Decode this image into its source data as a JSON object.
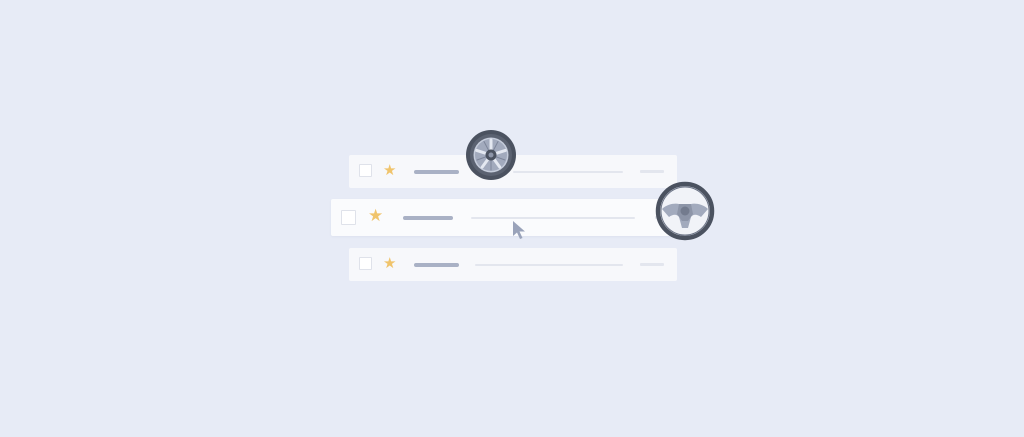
{
  "illustration": {
    "rows": [
      {
        "starred": true,
        "selected": false
      },
      {
        "starred": true,
        "selected": false,
        "emphasized": true
      },
      {
        "starred": true,
        "selected": false
      }
    ],
    "star_glyph": "★",
    "icons": {
      "wheel": "car-wheel-icon",
      "steering": "steering-wheel-icon",
      "cursor": "mouse-pointer-icon",
      "star": "star-icon",
      "checkbox": "checkbox"
    },
    "colors": {
      "background": "#e7ebf6",
      "row": "#f7f8fb",
      "star": "#f0c46c",
      "sender_bar": "#a9b1c5",
      "tire": "#4b5260",
      "rim": "#a2aabd",
      "cursor": "#9aa3ba"
    }
  }
}
